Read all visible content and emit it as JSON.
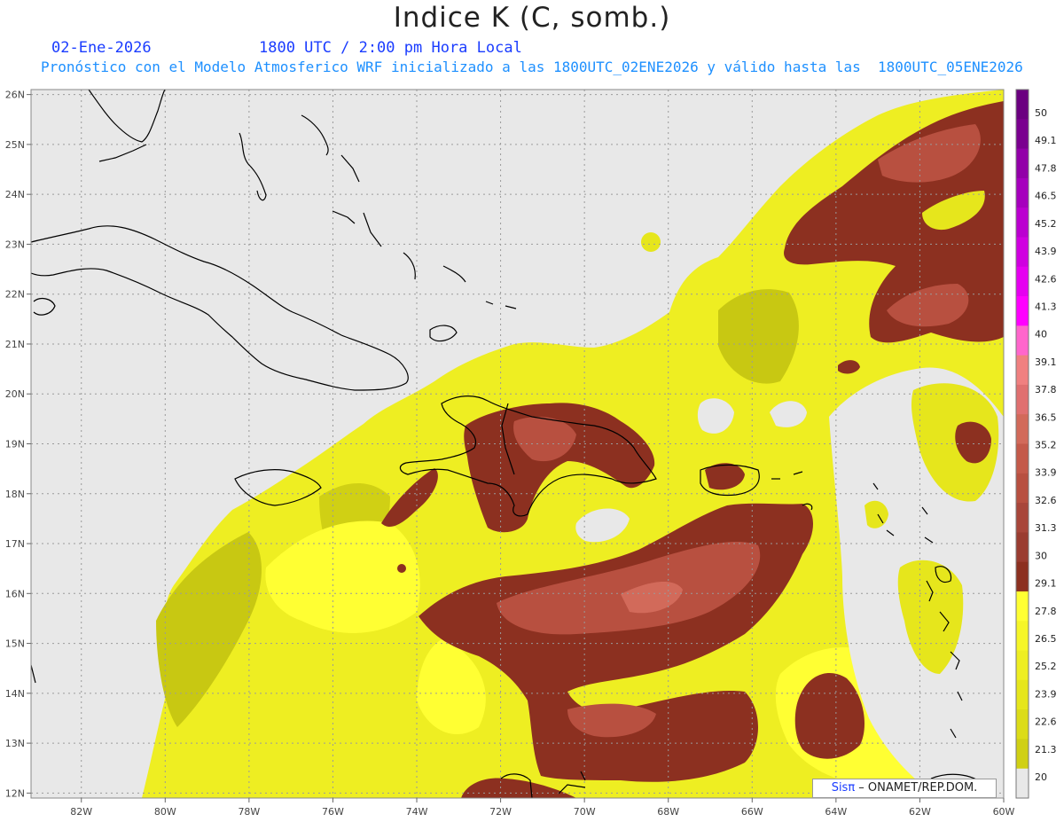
{
  "header": {
    "title": "Indice K (C, somb.)",
    "date": "02-Ene-2026",
    "time": "1800 UTC / 2:00 pm Hora Local",
    "subtitle": "Pronóstico con el Modelo Atmosferico WRF inicializado a las 1800UTC_02ENE2026 y válido hasta las  1800UTC_05ENE2026"
  },
  "axes": {
    "lon_labels": [
      "82W",
      "80W",
      "78W",
      "76W",
      "74W",
      "72W",
      "70W",
      "68W",
      "66W",
      "64W",
      "62W",
      "60W"
    ],
    "lat_labels": [
      "26N",
      "25N",
      "24N",
      "23N",
      "22N",
      "21N",
      "20N",
      "19N",
      "18N",
      "17N",
      "16N",
      "15N",
      "14N",
      "13N",
      "12N"
    ],
    "lon_range": [
      -83.2,
      -60.0
    ],
    "lat_range": [
      11.9,
      26.1
    ]
  },
  "colorbar": {
    "labels": [
      "50",
      "49.1",
      "47.8",
      "46.5",
      "45.2",
      "43.9",
      "42.6",
      "41.3",
      "40",
      "39.1",
      "37.8",
      "36.5",
      "35.2",
      "33.9",
      "32.6",
      "31.3",
      "30",
      "29.1",
      "27.8",
      "26.5",
      "25.2",
      "23.9",
      "22.6",
      "21.3",
      "20"
    ],
    "colors": {
      "c50": "#6b0080",
      "c49": "#7a008f",
      "c48": "#9200a8",
      "c47": "#a600bd",
      "c46": "#bb00d0",
      "c45": "#d000e0",
      "c44": "#e600f0",
      "c43": "#ff00ff",
      "c41": "#ff66cc",
      "c40": "#f08080",
      "c39": "#e07070",
      "c38": "#d26a5a",
      "c37": "#c45a4a",
      "c36": "#b85040",
      "c35": "#a8463a",
      "c33": "#9a3c30",
      "c32": "#8c3020",
      "c30": "#ffff33",
      "c29": "#f6f628",
      "c28": "#eeee22",
      "c27": "#e6e61c",
      "c25": "#dcdc18",
      "c24": "#d0d014",
      "c23": "#c4c410",
      "c21": "#bcbc0c",
      "c20": "#e8e8e8"
    }
  },
  "legend": {
    "brand": "Sisπ",
    "org": " – ONAMET/REP.DOM."
  }
}
